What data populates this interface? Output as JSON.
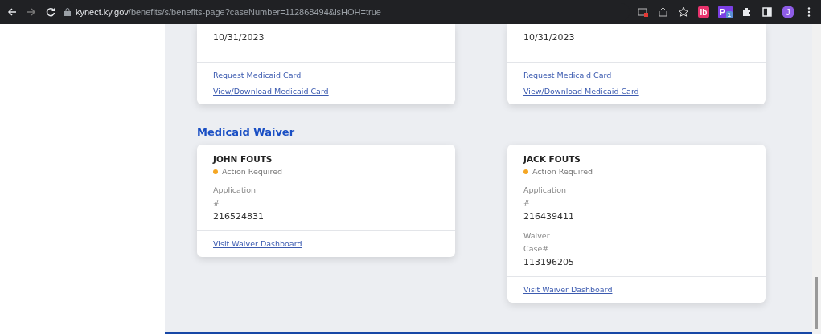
{
  "browser": {
    "url_host": "kynect.ky.gov",
    "url_path": "/benefits/s/benefits-page?caseNumber=112868494&isHOH=true",
    "extensions": [
      {
        "label": "ib",
        "color": "#e8336d"
      },
      {
        "label": "P",
        "badge": "1",
        "color": "#7b3fe4"
      }
    ],
    "avatar": "J"
  },
  "top_cards": [
    {
      "value": "10/31/2023",
      "links": [
        "Request Medicaid Card",
        "View/Download Medicaid Card"
      ]
    },
    {
      "value": "10/31/2023",
      "links": [
        "Request Medicaid Card",
        "View/Download Medicaid Card"
      ]
    }
  ],
  "section_title": "Medicaid Waiver",
  "waiver_cards": [
    {
      "name": "JOHN FOUTS",
      "status": {
        "text": "Action Required",
        "color": "#f5a623"
      },
      "fields": [
        {
          "label": "Application #",
          "value": "216524831"
        }
      ],
      "link": "Visit Waiver Dashboard"
    },
    {
      "name": "JACK FOUTS",
      "status": {
        "text": "Action Required",
        "color": "#f5a623"
      },
      "fields": [
        {
          "label": "Application #",
          "value": "216439411"
        },
        {
          "label": "Waiver Case#",
          "value": "113196205"
        }
      ],
      "link": "Visit Waiver Dashboard"
    }
  ]
}
